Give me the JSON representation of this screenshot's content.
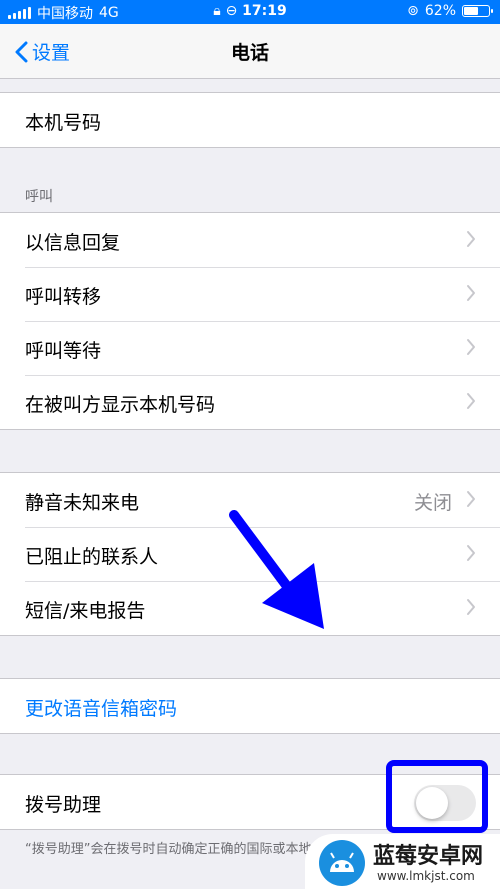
{
  "status": {
    "carrier": "中国移动",
    "network": "4G",
    "time": "17:19",
    "battery_label": "62%",
    "battery_level": 0.62
  },
  "nav": {
    "back_label": "设置",
    "title": "电话"
  },
  "group1": {
    "my_number": "本机号码"
  },
  "calls_section": {
    "header": "呼叫",
    "items": [
      "以信息回复",
      "呼叫转移",
      "呼叫等待",
      "在被叫方显示本机号码"
    ]
  },
  "group3": {
    "silence_unknown": "静音未知来电",
    "silence_unknown_value": "关闭",
    "blocked": "已阻止的联系人",
    "report": "短信/来电报告"
  },
  "voicemail": {
    "change_password": "更改语音信箱密码"
  },
  "dial_assist": {
    "label": "拨号助理",
    "enabled": false,
    "footer": "“拨号助理”会在拨号时自动确定正确的国际或本地前缀"
  },
  "watermark": {
    "title": "蓝莓安卓网",
    "url": "www.lmkjst.com"
  },
  "colors": {
    "accent": "#007aff",
    "annotation": "#0000ff",
    "background": "#efeff4"
  }
}
